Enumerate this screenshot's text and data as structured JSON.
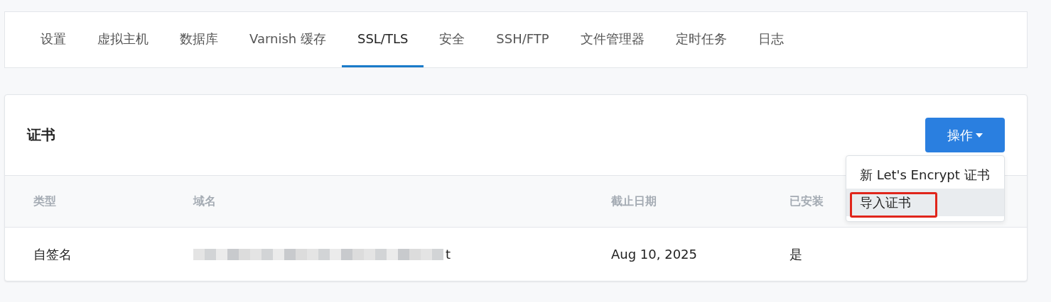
{
  "tabs": [
    {
      "label": "设置",
      "selected": false
    },
    {
      "label": "虚拟主机",
      "selected": false
    },
    {
      "label": "数据库",
      "selected": false
    },
    {
      "label": "Varnish 缓存",
      "selected": false
    },
    {
      "label": "SSL/TLS",
      "selected": true
    },
    {
      "label": "安全",
      "selected": false
    },
    {
      "label": "SSH/FTP",
      "selected": false
    },
    {
      "label": "文件管理器",
      "selected": false
    },
    {
      "label": "定时任务",
      "selected": false
    },
    {
      "label": "日志",
      "selected": false
    }
  ],
  "certificates": {
    "title": "证书",
    "action_button": "操作",
    "menu": [
      {
        "label": "新 Let's Encrypt 证书",
        "selected": false,
        "outlined": false
      },
      {
        "label": "导入证书",
        "selected": true,
        "outlined": true
      }
    ],
    "columns": [
      "类型",
      "域名",
      "截止日期",
      "已安装"
    ],
    "rows": [
      {
        "type": "自签名",
        "domain_visible_end": "t",
        "expires": "Aug 10, 2025",
        "installed": "是"
      }
    ]
  }
}
